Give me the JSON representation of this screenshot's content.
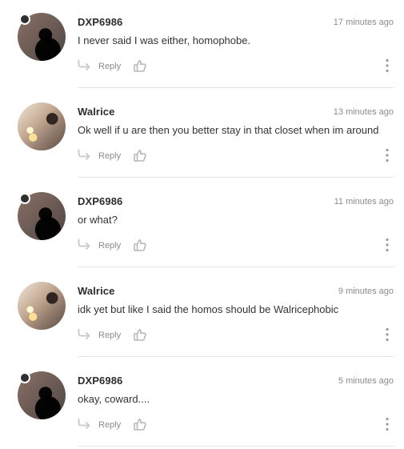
{
  "comments": [
    {
      "author": "DXP6986",
      "timestamp": "17 minutes ago",
      "text": "I never said I was either, homophobe.",
      "reply_label": "Reply"
    },
    {
      "author": "Walrice",
      "timestamp": "13 minutes ago",
      "text": "Ok well if u are then you better stay in that closet when im around",
      "reply_label": "Reply"
    },
    {
      "author": "DXP6986",
      "timestamp": "11 minutes ago",
      "text": "or what?",
      "reply_label": "Reply"
    },
    {
      "author": "Walrice",
      "timestamp": "9 minutes ago",
      "text": "idk yet but like I said the homos should be Walricephobic",
      "reply_label": "Reply"
    },
    {
      "author": "DXP6986",
      "timestamp": "5 minutes ago",
      "text": "okay, coward....",
      "reply_label": "Reply"
    }
  ],
  "icons": {
    "reply": "reply-arrow-icon",
    "like": "thumbs-up-icon",
    "menu": "vertical-ellipsis-icon",
    "presence": "presence-dot"
  },
  "colors": {
    "text_primary": "#2d2d2d",
    "text_secondary": "#8c8c8c",
    "divider": "#e4e4e4",
    "presence_dot": "#2f2f2f"
  }
}
